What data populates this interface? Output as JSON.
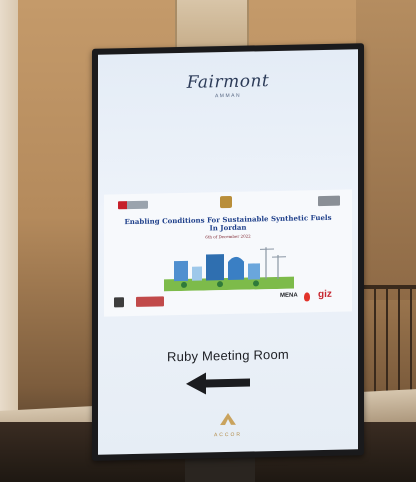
{
  "screen": {
    "brand_name": "Fairmont",
    "brand_city": "AMMAN",
    "event": {
      "title_line1": "Enabling Conditions For Sustainable Synthetic Fuels",
      "title_line2": "In Jordan",
      "date": "6th of December 2022"
    },
    "partners": {
      "mena": "MENA",
      "giz": "giz"
    },
    "room_name": "Ruby Meeting Room",
    "direction_icon": "arrow-left-icon",
    "footer_brand": "ACCOR"
  },
  "colors": {
    "title_blue": "#1e3f8a",
    "date_red": "#7a1f2a",
    "accor_gold": "#b28d4a"
  }
}
